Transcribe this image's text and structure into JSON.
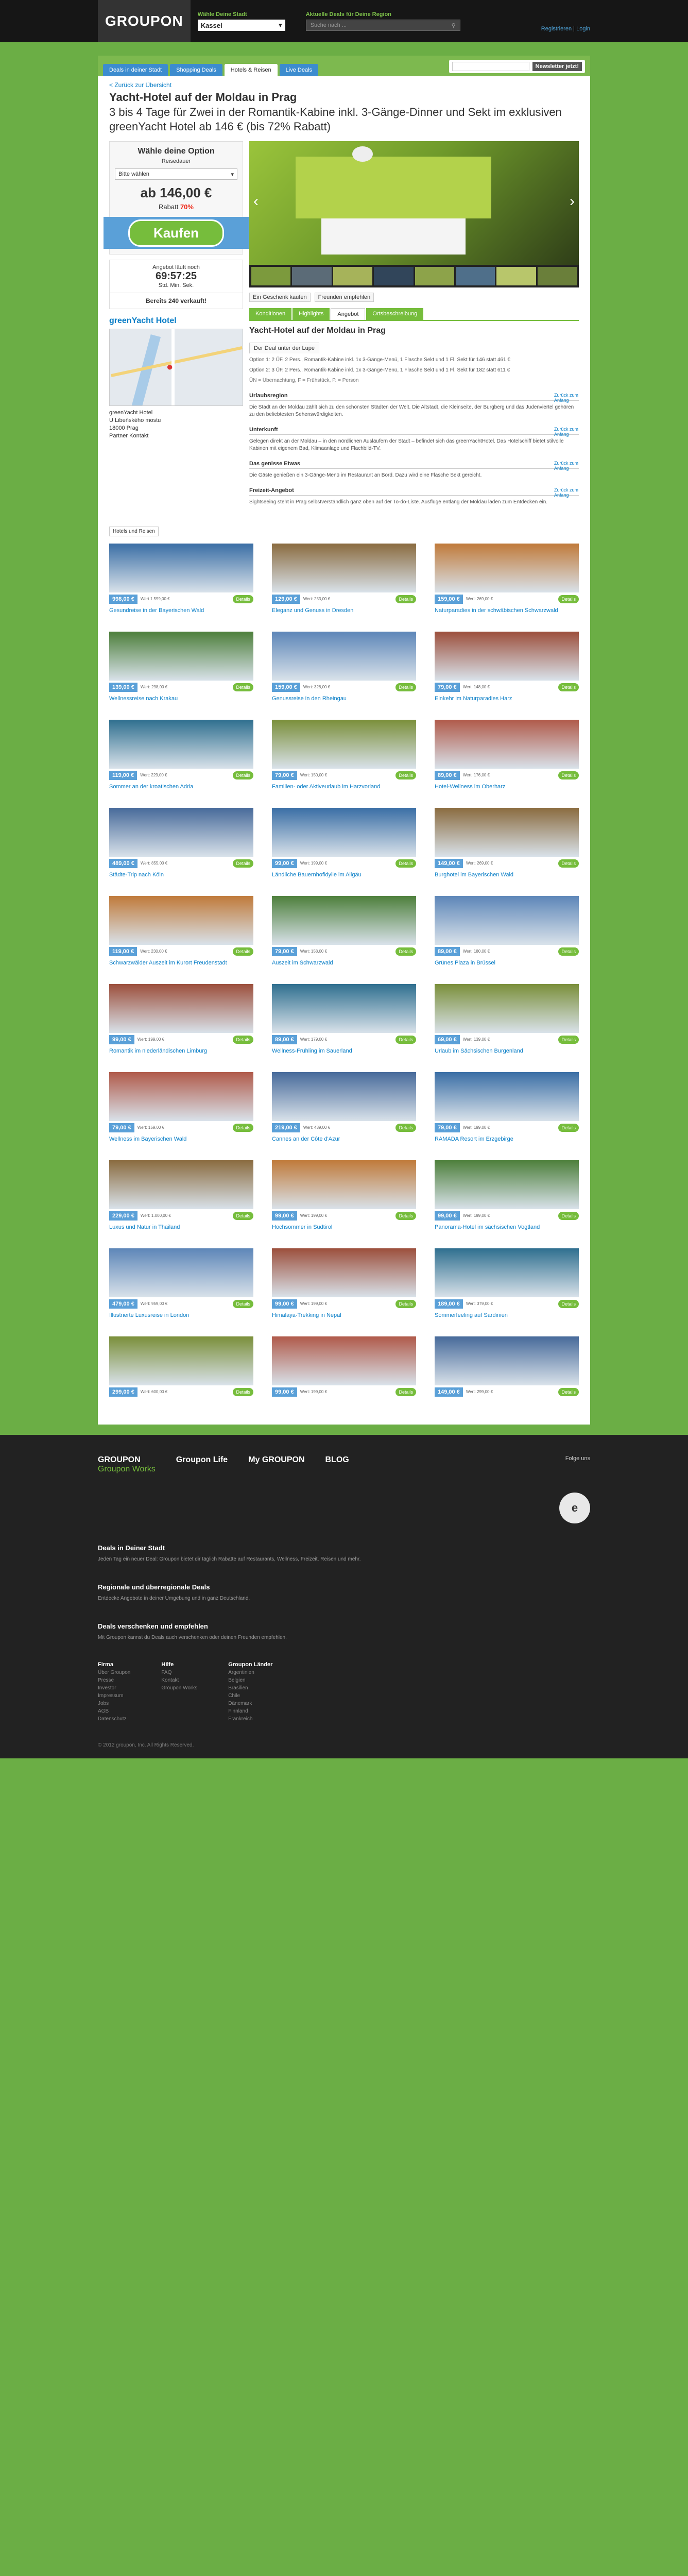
{
  "header": {
    "logo": "GROUPON",
    "city_label": "Wähle Deine Stadt",
    "city_value": "Kassel",
    "search_label": "Aktuelle Deals für Deine Region",
    "search_placeholder": "Suche nach ...",
    "user_register": "Registrieren",
    "user_login": "Login"
  },
  "tabs": [
    {
      "label": "Deals in deiner Stadt"
    },
    {
      "label": "Shopping Deals"
    },
    {
      "label": "Hotels & Reisen"
    },
    {
      "label": "Live Deals"
    }
  ],
  "newsletter": {
    "placeholder": "",
    "button": "Newsletter jetzt!"
  },
  "deal": {
    "back_link": "< Zurück zur Übersicht",
    "title": "Yacht-Hotel auf der Moldau in Prag",
    "subtitle": "3 bis 4 Tage für Zwei in der Romantik-Kabine inkl. 3-Gänge-Dinner und Sekt im exklusiven greenYacht Hotel ab 146 € (bis 72% Rabatt)",
    "option_title": "Wähle deine Option",
    "option_sub": "Reisedauer",
    "option_select": "Bitte wählen",
    "price": "ab 146,00 €",
    "discount_label": "Rabatt",
    "discount_value": "70%",
    "buy_label": "Kaufen",
    "countdown_label": "Angebot läuft noch",
    "countdown_time": "69:57:25",
    "countdown_units": "Std.  Min.  Sek.",
    "sold": "Bereits 240 verkauft!",
    "merchant": "greenYacht Hotel",
    "address": "greenYacht Hotel\nU Libeňského mostu\n18000 Prag\nPartner Kontakt",
    "share_label": "Ein Geschenk kaufen",
    "share_recommend": "Freunden empfehlen",
    "section_tabs": [
      "Konditionen",
      "Highlights",
      "Angebot",
      "Ortsbeschreibung"
    ],
    "article_title": "Yacht-Hotel auf der Moldau in Prag",
    "box_title": "Der Deal unter der Lupe",
    "option1": "Option 1: 2 ÜF, 2 Pers., Romantik-Kabine inkl. 1x 3-Gänge-Menü, 1 Flasche Sekt und 1 Fl. Sekt für 146 statt 461 €",
    "option2": "Option 2: 3 ÜF, 2 Pers., Romantik-Kabine inkl. 1x 3-Gänge-Menü, 1 Flasche Sekt und 1 Fl. Sekt für 182 statt 611 €",
    "legend": "ÜN = Übernachtung, F = Frühstück, P. = Person",
    "sections": [
      {
        "title": "Urlaubsregion",
        "to_top": "Zurück zum Anfang"
      },
      {
        "title": "Unterkunft",
        "to_top": "Zurück zum Anfang"
      },
      {
        "title": "Das genisse Etwas",
        "to_top": "Zurück zum Anfang"
      },
      {
        "title": "Freizeit-Angebot",
        "to_top": "Zurück zum Anfang"
      }
    ],
    "p_region": "Die Stadt an der Moldau zählt sich zu den schönsten Städten der Welt. Die Altstadt, die Kleinseite, der Burgberg und das Judenviertel gehören zu den beliebtesten Sehenswürdigkeiten.",
    "p_unterkunft": "Gelegen direkt an der Moldau – in den nördlichen Ausläufern der Stadt – befindet sich das greenYachtHotel. Das Hotelschiff bietet stilvolle Kabinen mit eigenem Bad, Klimaanlage und Flachbild-TV.",
    "p_etwas": "Die Gäste genießen ein 3-Gänge-Menü im Restaurant an Bord. Dazu wird eine Flasche Sekt gereicht.",
    "p_freizeit": "Sightseeing steht in Prag selbstverständlich ganz oben auf der To-do-Liste. Ausflüge entlang der Moldau laden zum Entdecken ein.",
    "related_label": "Hotels und Reisen"
  },
  "related": [
    {
      "price": "998,00 €",
      "was": "Wert 1.599,00 €",
      "name": "Gesundreise in der Bayerischen Wald",
      "btn": "Details"
    },
    {
      "price": "129,00 €",
      "was": "Wert: 253,00 €",
      "name": "Eleganz und Genuss in Dresden",
      "btn": "Details"
    },
    {
      "price": "159,00 €",
      "was": "Wert: 269,00 €",
      "name": "Naturparadies in der schwäbischen Schwarzwald",
      "btn": "Details"
    },
    {
      "price": "139,00 €",
      "was": "Wert: 298,00 €",
      "name": "Wellnessreise nach Krakau",
      "btn": "Details"
    },
    {
      "price": "159,00 €",
      "was": "Wert: 328,00 €",
      "name": "Genussreise in den Rheingau",
      "btn": "Details"
    },
    {
      "price": "79,00 €",
      "was": "Wert: 148,00 €",
      "name": "Einkehr im Naturparadies Harz",
      "btn": "Details"
    },
    {
      "price": "119,00 €",
      "was": "Wert: 229,00 €",
      "name": "Sommer an der kroatischen Adria",
      "btn": "Details"
    },
    {
      "price": "79,00 €",
      "was": "Wert: 150,00 €",
      "name": "Familien- oder Aktiveurlaub im Harzvorland",
      "btn": "Details"
    },
    {
      "price": "89,00 €",
      "was": "Wert: 176,00 €",
      "name": "Hotel-Wellness im Oberharz",
      "btn": "Details"
    },
    {
      "price": "489,00 €",
      "was": "Wert: 855,00 €",
      "name": "Städte-Trip nach Köln",
      "btn": "Details"
    },
    {
      "price": "99,00 €",
      "was": "Wert: 199,00 €",
      "name": "Ländliche Bauernhofidylle im Allgäu",
      "btn": "Details"
    },
    {
      "price": "149,00 €",
      "was": "Wert: 269,00 €",
      "name": "Burghotel im Bayerischen Wald",
      "btn": "Details"
    },
    {
      "price": "119,00 €",
      "was": "Wert: 230,00 €",
      "name": "Schwarzwälder Auszeit im Kurort Freudenstadt",
      "btn": "Details"
    },
    {
      "price": "79,00 €",
      "was": "Wert: 158,00 €",
      "name": "Auszeit im Schwarzwald",
      "btn": "Details"
    },
    {
      "price": "89,00 €",
      "was": "Wert: 180,00 €",
      "name": "Grünes Plaza in Brüssel",
      "btn": "Details"
    },
    {
      "price": "99,00 €",
      "was": "Wert: 199,00 €",
      "name": "Romantik im niederländischen Limburg",
      "btn": "Details"
    },
    {
      "price": "89,00 €",
      "was": "Wert: 179,00 €",
      "name": "Wellness-Frühling im Sauerland",
      "btn": "Details"
    },
    {
      "price": "69,00 €",
      "was": "Wert: 139,00 €",
      "name": "Urlaub im Sächsischen Burgenland",
      "btn": "Details"
    },
    {
      "price": "79,00 €",
      "was": "Wert: 159,00 €",
      "name": "Wellness im Bayerischen Wald",
      "btn": "Details"
    },
    {
      "price": "219,00 €",
      "was": "Wert: 439,00 €",
      "name": "Cannes an der Côte d'Azur",
      "btn": "Details"
    },
    {
      "price": "79,00 €",
      "was": "Wert: 199,00 €",
      "name": "RAMADA Resort im Erzgebirge",
      "btn": "Details"
    },
    {
      "price": "229,00 €",
      "was": "Wert: 1.000,00 €",
      "name": "Luxus und Natur in Thailand",
      "btn": "Details"
    },
    {
      "price": "99,00 €",
      "was": "Wert: 199,00 €",
      "name": "Hochsommer in Südtirol",
      "btn": "Details"
    },
    {
      "price": "99,00 €",
      "was": "Wert: 199,00 €",
      "name": "Panorama-Hotel im sächsischen Vogtland",
      "btn": "Details"
    },
    {
      "price": "479,00 €",
      "was": "Wert: 959,00 €",
      "name": "Illustrierte Luxusreise in London",
      "btn": "Details"
    },
    {
      "price": "99,00 €",
      "was": "Wert: 199,00 €",
      "name": "Himalaya-Trekking in Nepal",
      "btn": "Details"
    },
    {
      "price": "189,00 €",
      "was": "Wert: 379,00 €",
      "name": "Sommerfeeling auf Sardinien",
      "btn": "Details"
    },
    {
      "price": "299,00 €",
      "was": "Wert: 600,00 €",
      "name": "",
      "btn": "Details"
    },
    {
      "price": "99,00 €",
      "was": "Wert: 199,00 €",
      "name": "",
      "btn": "Details"
    },
    {
      "price": "149,00 €",
      "was": "Wert: 299,00 €",
      "name": "",
      "btn": "Details"
    }
  ],
  "footer": {
    "brand1": "GROUPON",
    "brand1_sub": "Groupon Works",
    "brand2": "Groupon Life",
    "brand3": "My GROUPON",
    "brand4": "BLOG",
    "social_label": "Folge uns",
    "badge": "e",
    "section1": "Deals in Deiner Stadt",
    "section1_text": "Jeden Tag ein neuer Deal: Groupon bietet dir täglich Rabatte auf Restaurants, Wellness, Freizeit, Reisen und mehr.",
    "section2": "Regionale und überregionale Deals",
    "section2_text": "Entdecke Angebote in deiner Umgebung und in ganz Deutschland.",
    "section3": "Deals verschenken und empfehlen",
    "section3_text": "Mit Groupon kannst du Deals auch verschenken oder deinen Freunden empfehlen.",
    "col1_title": "Firma",
    "col1_links": [
      "Über Groupon",
      "Presse",
      "Investor",
      "Impressum",
      "Jobs",
      "AGB",
      "Datenschutz"
    ],
    "col2_title": "Hilfe",
    "col2_links": [
      "FAQ",
      "Kontakt",
      "Groupon Works"
    ],
    "col3_title": "Groupon Länder",
    "col3_links": [
      "Argentinien",
      "Belgien",
      "Brasilien",
      "Chile",
      "Dänemark",
      "Finnland",
      "Frankreich"
    ],
    "copyright": "© 2012 groupon, Inc. All Rights Reserved."
  },
  "colors": {
    "brand_green": "#76bd3c",
    "link_blue": "#0b7fc7",
    "discount_red": "#e21"
  }
}
